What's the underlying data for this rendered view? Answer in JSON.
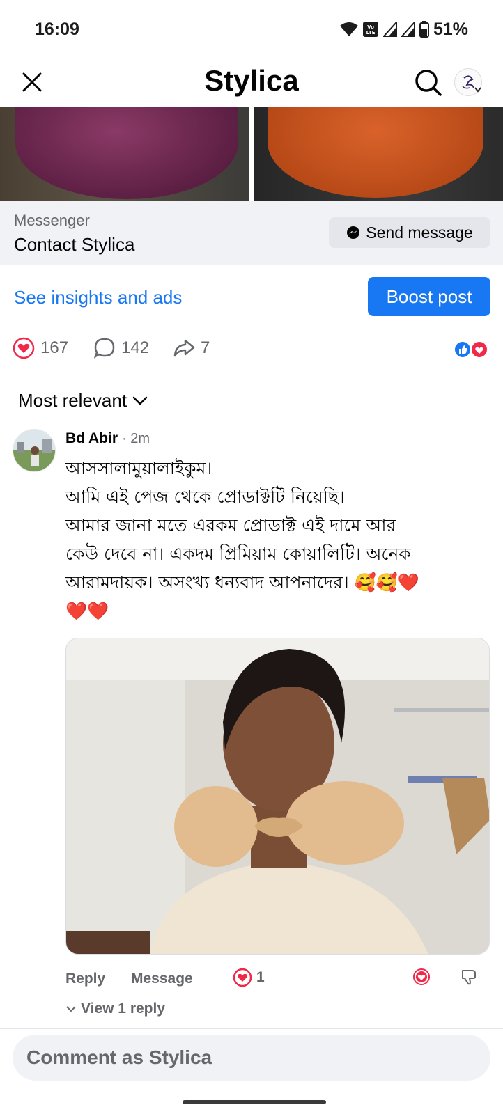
{
  "status_bar": {
    "time": "16:09",
    "battery": "51%",
    "icons": [
      "wifi-icon",
      "volte-icon",
      "signal-icon",
      "signal-icon",
      "battery-icon"
    ]
  },
  "header": {
    "title": "Stylica",
    "close_icon": "close-icon",
    "search_icon": "search-icon",
    "avatar_icon": "page-avatar-icon"
  },
  "messenger": {
    "label": "Messenger",
    "contact": "Contact Stylica",
    "send_button": "Send message"
  },
  "insights": {
    "link": "See insights and ads",
    "boost_button": "Boost post"
  },
  "engagement": {
    "reactions": "167",
    "comments": "142",
    "shares": "7"
  },
  "sort": {
    "label": "Most relevant"
  },
  "comment": {
    "author": "Bd Abir",
    "time": "· 2m",
    "lines": [
      "আসসালামুয়ালাইকুম।",
      "আমি এই পেজ থেকে প্রোডাক্টটি নিয়েছি।",
      "আমার জানা মতে এরকম প্রোডাক্ট এই দামে আর",
      "কেউ দেবে না। একদম প্রিমিয়াম কোয়ালিটি। অনেক",
      "আরামদায়ক।  অসংখ্য ধন্যবাদ আপনাদের। 🥰🥰❤️",
      "❤️❤️"
    ],
    "reply": "Reply",
    "message": "Message",
    "reaction_count": "1",
    "view_replies": "View 1 reply"
  },
  "composer": {
    "placeholder": "Comment as Stylica"
  },
  "colors": {
    "accent": "#1877f2",
    "heart": "#f02849",
    "muted": "#65676b"
  }
}
